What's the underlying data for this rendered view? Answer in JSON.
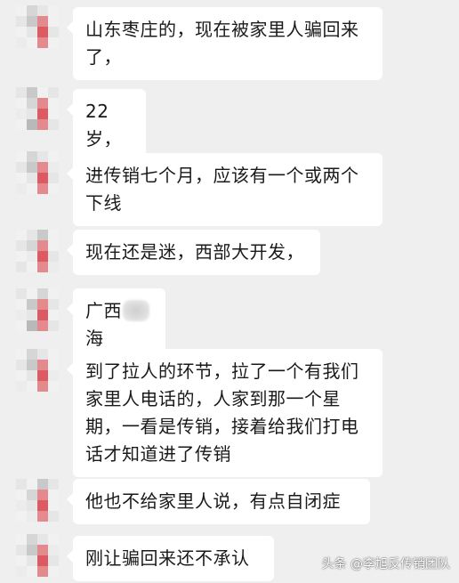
{
  "messages": [
    {
      "lines": [
        "山东枣庄的，现在被家里人骗回来",
        "了，"
      ]
    },
    {
      "lines": [
        "22岁，"
      ]
    },
    {
      "lines": [
        "进传销七个月，应该有一个或两个",
        "下线"
      ]
    },
    {
      "lines": [
        "现在还是迷，西部大开发，"
      ]
    },
    {
      "prefix": "广西",
      "suffix": "海"
    },
    {
      "lines": [
        "到了拉人的环节，拉了一个有我们",
        "家里人电话的，人家到那一个星",
        "期，一看是传销，接着给我们打电",
        "话才知道进了传销"
      ]
    },
    {
      "lines": [
        "他也不给家里人说，有点自闭症"
      ]
    },
    {
      "lines": [
        "刚让骗回来还不承认"
      ]
    }
  ],
  "watermark": "头条 @李旭反传销团队"
}
